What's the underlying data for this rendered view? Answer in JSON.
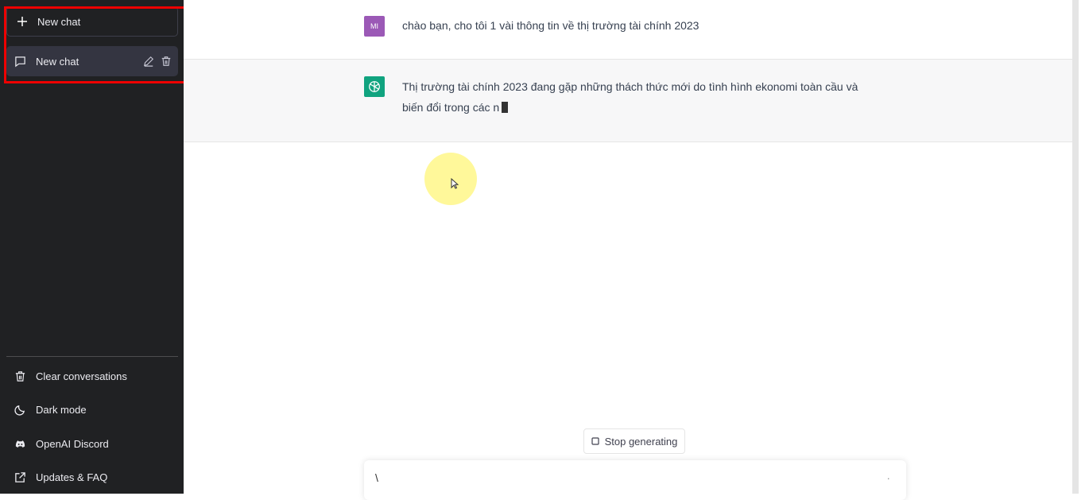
{
  "sidebar": {
    "new_chat_label": "New chat",
    "chats": [
      {
        "label": "New chat"
      }
    ],
    "bottom": [
      {
        "label": "Clear conversations",
        "icon": "trash-icon"
      },
      {
        "label": "Dark mode",
        "icon": "moon-icon"
      },
      {
        "label": "OpenAI Discord",
        "icon": "discord-icon"
      },
      {
        "label": "Updates & FAQ",
        "icon": "external-link-icon"
      }
    ]
  },
  "conversation": {
    "user": {
      "avatar": "MI",
      "avatar_color": "#9b59b6",
      "text": "chào bạn, cho tôi 1 vài thông tin về thị trường tài chính 2023"
    },
    "assistant": {
      "avatar_color": "#10a37f",
      "text": "Thị trường tài chính 2023 đang gặp những thách thức mới do tình hình ekonomi toàn cầu và biến đổi trong các n"
    }
  },
  "stop_label": "Stop generating",
  "input": {
    "value": "\\",
    "trailing": "·"
  }
}
